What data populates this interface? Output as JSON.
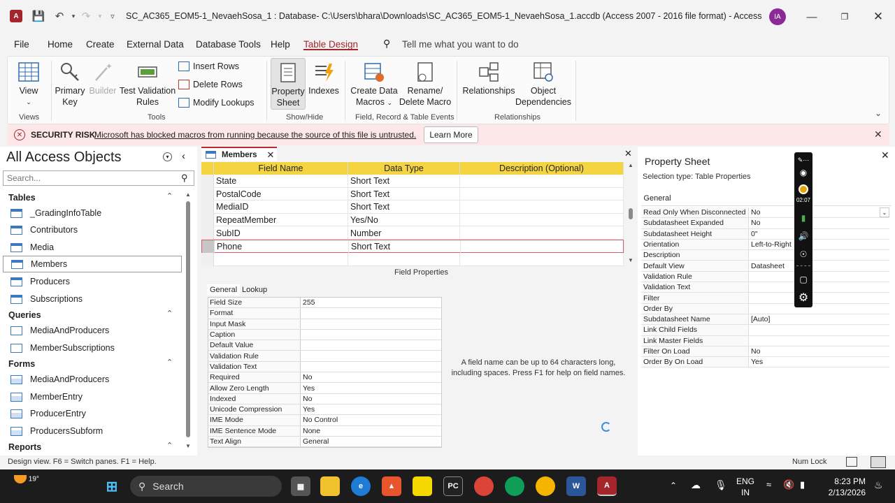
{
  "titlebar": {
    "title": "SC_AC365_EOM5-1_NevaehSosa_1 : Database- C:\\Users\\bhara\\Downloads\\SC_AC365_EOM5-1_NevaehSosa_1.accdb (Access 2007 - 2016 file format)  -  Access",
    "avatar_initials": "IA"
  },
  "menu": {
    "file": "File",
    "home": "Home",
    "create": "Create",
    "external": "External Data",
    "dbtools": "Database Tools",
    "help": "Help",
    "tabledesign": "Table Design",
    "tellme": "Tell me what you want to do"
  },
  "ribbon": {
    "view": "View",
    "primary_key_1": "Primary",
    "primary_key_2": "Key",
    "builder": "Builder",
    "test_val_1": "Test Validation",
    "test_val_2": "Rules",
    "insert_rows": "Insert Rows",
    "delete_rows": "Delete Rows",
    "modify_lookups": "Modify Lookups",
    "property_1": "Property",
    "property_2": "Sheet",
    "indexes": "Indexes",
    "create_macros_1": "Create Data",
    "create_macros_2": "Macros",
    "rename_macro_1": "Rename/",
    "rename_macro_2": "Delete Macro",
    "relationships": "Relationships",
    "object_dep_1": "Object",
    "object_dep_2": "Dependencies",
    "groups": {
      "views": "Views",
      "tools": "Tools",
      "showhide": "Show/Hide",
      "events": "Field, Record & Table Events",
      "relationships": "Relationships"
    }
  },
  "security": {
    "title": "SECURITY RISK",
    "message": "Microsoft has blocked macros from running because the source of this file is untrusted.",
    "learn_more": "Learn More"
  },
  "nav": {
    "title": "All Access Objects",
    "search_placeholder": "Search...",
    "tables_head": "Tables",
    "tables": [
      "_GradingInfoTable",
      "Contributors",
      "Media",
      "Members",
      "Producers",
      "Subscriptions"
    ],
    "queries_head": "Queries",
    "queries": [
      "MediaAndProducers",
      "MemberSubscriptions"
    ],
    "forms_head": "Forms",
    "forms": [
      "MediaAndProducers",
      "MemberEntry",
      "ProducerEntry",
      "ProducersSubform"
    ],
    "reports_head": "Reports"
  },
  "doc": {
    "tab_name": "Members",
    "columns": [
      "Field Name",
      "Data Type",
      "Description (Optional)"
    ],
    "rows": [
      {
        "name": "State",
        "type": "Short Text"
      },
      {
        "name": "PostalCode",
        "type": "Short Text"
      },
      {
        "name": "MediaID",
        "type": "Short Text"
      },
      {
        "name": "RepeatMember",
        "type": "Yes/No"
      },
      {
        "name": "SubID",
        "type": "Number"
      },
      {
        "name": "Phone",
        "type": "Short Text"
      }
    ],
    "field_properties_title": "Field Properties",
    "fp_tab_general": "General",
    "fp_tab_lookup": "Lookup",
    "field_props": [
      [
        "Field Size",
        "255"
      ],
      [
        "Format",
        ""
      ],
      [
        "Input Mask",
        ""
      ],
      [
        "Caption",
        ""
      ],
      [
        "Default Value",
        ""
      ],
      [
        "Validation Rule",
        ""
      ],
      [
        "Validation Text",
        ""
      ],
      [
        "Required",
        "No"
      ],
      [
        "Allow Zero Length",
        "Yes"
      ],
      [
        "Indexed",
        "No"
      ],
      [
        "Unicode Compression",
        "Yes"
      ],
      [
        "IME Mode",
        "No Control"
      ],
      [
        "IME Sentence Mode",
        "None"
      ],
      [
        "Text Align",
        "General"
      ]
    ],
    "help_text": "A field name can be up to 64 characters long, including spaces. Press F1 for help on field names."
  },
  "property_sheet": {
    "title": "Property Sheet",
    "selection_type": "Selection type:  Table Properties",
    "tab": "General",
    "props": [
      [
        "Read Only When Disconnected",
        "No"
      ],
      [
        "Subdatasheet Expanded",
        "No"
      ],
      [
        "Subdatasheet Height",
        "0\""
      ],
      [
        "Orientation",
        "Left-to-Right"
      ],
      [
        "Description",
        ""
      ],
      [
        "Default View",
        "Datasheet"
      ],
      [
        "Validation Rule",
        ""
      ],
      [
        "Validation Text",
        ""
      ],
      [
        "Filter",
        ""
      ],
      [
        "Order By",
        ""
      ],
      [
        "Subdatasheet Name",
        "[Auto]"
      ],
      [
        "Link Child Fields",
        ""
      ],
      [
        "Link Master Fields",
        ""
      ],
      [
        "Filter On Load",
        "No"
      ],
      [
        "Order By On Load",
        "Yes"
      ]
    ]
  },
  "recorder": {
    "timer": "02:07"
  },
  "status": {
    "left": "Design view.  F6 = Switch panes.  F1 = Help.",
    "numlock": "Num Lock"
  },
  "taskbar": {
    "weather_temp": "19°",
    "search": "Search",
    "lang_1": "ENG",
    "lang_2": "IN",
    "time": "8:23 PM",
    "date": "2/13/2026"
  },
  "colors": {
    "accent": "#a4262c",
    "grid_header": "#f5d442",
    "security_bg": "#fde7e9"
  }
}
